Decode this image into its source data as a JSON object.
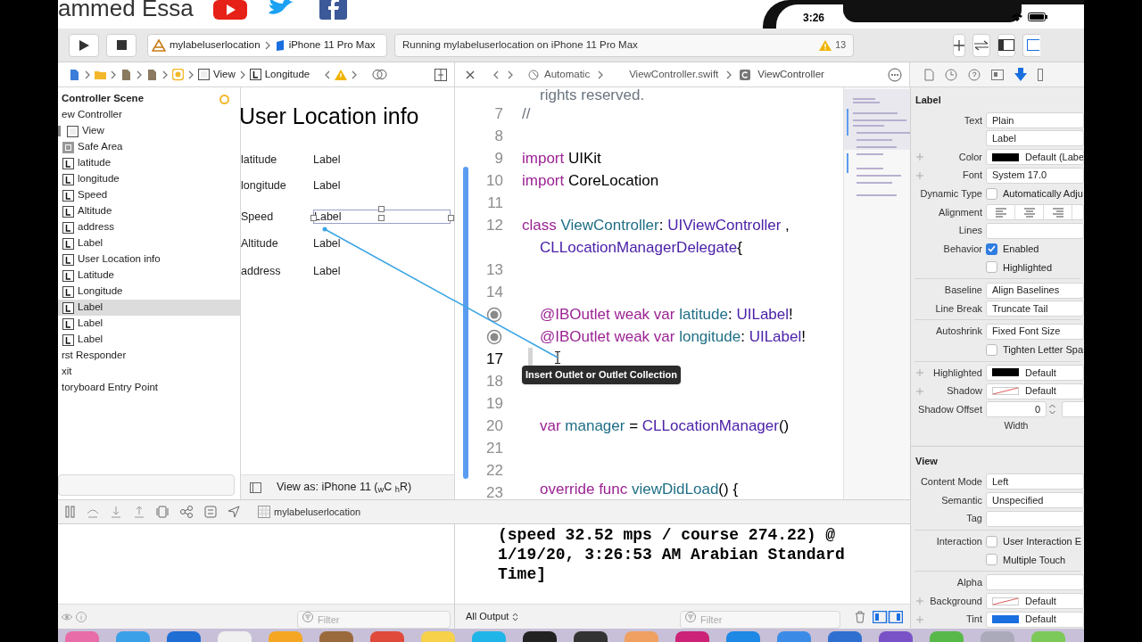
{
  "header": {
    "channel_name": "ammed Essa",
    "phone_time": "3:26"
  },
  "toolbar": {
    "scheme_target": "mylabeluserlocation",
    "scheme_device": "iPhone 11 Pro Max",
    "activity": "Running mylabeluserlocation on iPhone 11 Pro Max",
    "warning_count": "13"
  },
  "jump_bar": {
    "path": [
      {
        "kind": "view",
        "text": "View"
      },
      {
        "kind": "label",
        "text": "Longitude"
      }
    ]
  },
  "editor_bar": {
    "mode": "Automatic",
    "file": "ViewController.swift",
    "symbol": "ViewController"
  },
  "outline": {
    "items": [
      {
        "label": "Controller Scene",
        "kind": "scene",
        "selected": false,
        "children": [
          {
            "label": "ew Controller",
            "selected": false,
            "children": [
              {
                "label": "View",
                "kind": "view",
                "selected": false,
                "children": [
                  {
                    "label": "Safe Area",
                    "kind": "safearea",
                    "selected": false
                  },
                  {
                    "label": "latitude",
                    "kind": "label",
                    "selected": false
                  },
                  {
                    "label": "longitude",
                    "kind": "label",
                    "selected": false
                  },
                  {
                    "label": "Speed",
                    "kind": "label",
                    "selected": false
                  },
                  {
                    "label": "Altitude",
                    "kind": "label",
                    "selected": false
                  },
                  {
                    "label": "address",
                    "kind": "label",
                    "selected": false
                  },
                  {
                    "label": "Label",
                    "kind": "label",
                    "selected": false
                  },
                  {
                    "label": "User Location info",
                    "kind": "label",
                    "selected": false
                  },
                  {
                    "label": "Latitude",
                    "kind": "label",
                    "selected": false
                  },
                  {
                    "label": "Longitude",
                    "kind": "label",
                    "selected": false
                  },
                  {
                    "label": "Label",
                    "kind": "label",
                    "selected": true
                  },
                  {
                    "label": "Label",
                    "kind": "label",
                    "selected": false
                  },
                  {
                    "label": "Label",
                    "kind": "label",
                    "selected": false
                  }
                ]
              }
            ]
          },
          {
            "label": "rst Responder",
            "selected": false
          },
          {
            "label": "xit",
            "selected": false
          },
          {
            "label": "toryboard Entry Point",
            "selected": false
          }
        ]
      }
    ]
  },
  "canvas": {
    "title": "User Location info",
    "rows": [
      {
        "name": "latitude",
        "value": "Label",
        "selected": false
      },
      {
        "name": "longitude",
        "value": "Label",
        "selected": false
      },
      {
        "name": "Speed",
        "value": "Label",
        "selected": true
      },
      {
        "name": "Altitude",
        "value": "Label",
        "selected": false
      },
      {
        "name": "address",
        "value": "Label",
        "selected": false
      }
    ],
    "footer": "View as: iPhone 11 ($_{w}$C $_{h}$R)"
  },
  "code": {
    "lines": [
      {
        "indented": true,
        "tokens": [
          {
            "kind": "comment",
            "t": "rights reserved."
          }
        ]
      },
      {
        "number": "7",
        "current": false,
        "indented": false,
        "tokens": [
          {
            "kind": "comment",
            "t": "//"
          }
        ]
      },
      {
        "number": "8",
        "current": false
      },
      {
        "number": "9",
        "current": false,
        "indented": false,
        "tokens": [
          {
            "kind": "kw",
            "t": "import "
          },
          {
            "kind": "plain",
            "t": "UIKit"
          }
        ]
      },
      {
        "number": "10",
        "current": false,
        "indented": false,
        "tokens": [
          {
            "kind": "kw",
            "t": "import "
          },
          {
            "kind": "plain",
            "t": "CoreLocation"
          }
        ]
      },
      {
        "number": "11",
        "current": false
      },
      {
        "number": "12",
        "current": false,
        "indented": false,
        "tokens": [
          {
            "kind": "kw",
            "t": "class "
          },
          {
            "kind": "decl",
            "t": "ViewController"
          },
          {
            "kind": "plain",
            "t": ": "
          },
          {
            "kind": "type",
            "t": "UIViewController"
          },
          {
            "kind": "plain",
            "t": " ,"
          }
        ]
      },
      {
        "indented": true,
        "tokens": [
          {
            "kind": "type",
            "t": "CLLocationManagerDelegate"
          },
          {
            "kind": "plain",
            "t": "{"
          }
        ]
      },
      {
        "number": "13",
        "current": false
      },
      {
        "number": "14",
        "current": false
      },
      {
        "outlet_connected": true,
        "indented": true,
        "tokens": [
          {
            "kind": "kw",
            "t": "@IBOutlet weak var "
          },
          {
            "kind": "decl",
            "t": "latitude"
          },
          {
            "kind": "plain",
            "t": ": "
          },
          {
            "kind": "type",
            "t": "UILabel"
          },
          {
            "kind": "plain",
            "t": "!"
          }
        ]
      },
      {
        "outlet_connected": true,
        "indented": true,
        "tokens": [
          {
            "kind": "kw",
            "t": "@IBOutlet weak var "
          },
          {
            "kind": "decl",
            "t": "longitude"
          },
          {
            "kind": "plain",
            "t": ": "
          },
          {
            "kind": "type",
            "t": "UILabel"
          },
          {
            "kind": "plain",
            "t": "!"
          }
        ]
      },
      {
        "number": "17",
        "current": true
      },
      {
        "number": "18",
        "current": false
      },
      {
        "number": "19",
        "current": false
      },
      {
        "number": "20",
        "current": false,
        "indented": true,
        "tokens": [
          {
            "kind": "kw",
            "t": "var "
          },
          {
            "kind": "decl",
            "t": "manager"
          },
          {
            "kind": "plain",
            "t": " = "
          },
          {
            "kind": "type",
            "t": "CLLocationManager"
          },
          {
            "kind": "plain",
            "t": "()"
          }
        ]
      },
      {
        "number": "21",
        "current": false
      },
      {
        "number": "22",
        "current": false
      },
      {
        "number": "23",
        "current": false,
        "indented": true,
        "tokens": [
          {
            "kind": "kw",
            "t": "override func "
          },
          {
            "kind": "decl",
            "t": "viewDidLoad"
          },
          {
            "kind": "plain",
            "t": "() {"
          }
        ]
      }
    ],
    "tooltip": "Insert Outlet or Outlet Collection"
  },
  "debug_bar": {
    "target": "mylabeluserlocation"
  },
  "variables": {
    "filter_placeholder": "Filter"
  },
  "console": {
    "lines": [
      "(speed 32.52 mps / course 274.22) @",
      "1/19/20, 3:26:53 AM Arabian Standard",
      "Time]"
    ],
    "output_filter": "All Output",
    "filter_placeholder": "Filter"
  },
  "inspector": {
    "sections": [
      {
        "title": "Label",
        "groups": [
          [
            {
              "kind": "select",
              "label": "Text",
              "value": "Plain"
            },
            {
              "kind": "field",
              "value": "Label"
            },
            {
              "kind": "color",
              "label": "Color",
              "value": "Default (Labe",
              "color": "#000000",
              "plus": true
            },
            {
              "kind": "field",
              "label": "Font",
              "value": "System 17.0",
              "plus": true
            },
            {
              "kind": "checkbox",
              "label": "Dynamic Type",
              "text": "Automatically Adju",
              "checked": false
            },
            {
              "kind": "alignment",
              "label": "Alignment"
            },
            {
              "kind": "field",
              "label": "Lines"
            },
            {
              "kind": "checkbox",
              "label": "Behavior",
              "text": "Enabled",
              "checked": true
            },
            {
              "kind": "checkbox",
              "text": "Highlighted",
              "checked": false
            }
          ],
          [
            {
              "kind": "select",
              "label": "Baseline",
              "value": "Align Baselines"
            },
            {
              "kind": "select",
              "label": "Line Break",
              "value": "Truncate Tail"
            }
          ],
          [
            {
              "kind": "select",
              "label": "Autoshrink",
              "value": "Fixed Font Size"
            },
            {
              "kind": "checkbox",
              "text": "Tighten Letter Spa",
              "checked": false
            }
          ],
          [
            {
              "kind": "color",
              "label": "Highlighted",
              "value": "Default",
              "color": "#000000",
              "plus": true
            },
            {
              "kind": "nocolor",
              "label": "Shadow",
              "value": "Default",
              "plus": true
            },
            {
              "kind": "stepper",
              "label": "Shadow Offset",
              "value": "0",
              "caption": "Width"
            }
          ]
        ]
      },
      {
        "title": "View",
        "groups": [
          [
            {
              "kind": "select",
              "label": "Content Mode",
              "value": "Left"
            },
            {
              "kind": "select",
              "label": "Semantic",
              "value": "Unspecified"
            },
            {
              "kind": "field",
              "label": "Tag"
            }
          ],
          [
            {
              "kind": "checkbox",
              "label": "Interaction",
              "text": "User Interaction E",
              "checked": false
            },
            {
              "kind": "checkbox",
              "text": "Multiple Touch",
              "checked": false
            }
          ],
          [
            {
              "kind": "field",
              "label": "Alpha"
            },
            {
              "kind": "nocolor",
              "label": "Background",
              "value": "Default",
              "plus": true
            },
            {
              "kind": "color",
              "label": "Tint",
              "value": "Default",
              "color": "#1a6fe0",
              "plus": true
            }
          ]
        ]
      }
    ]
  }
}
